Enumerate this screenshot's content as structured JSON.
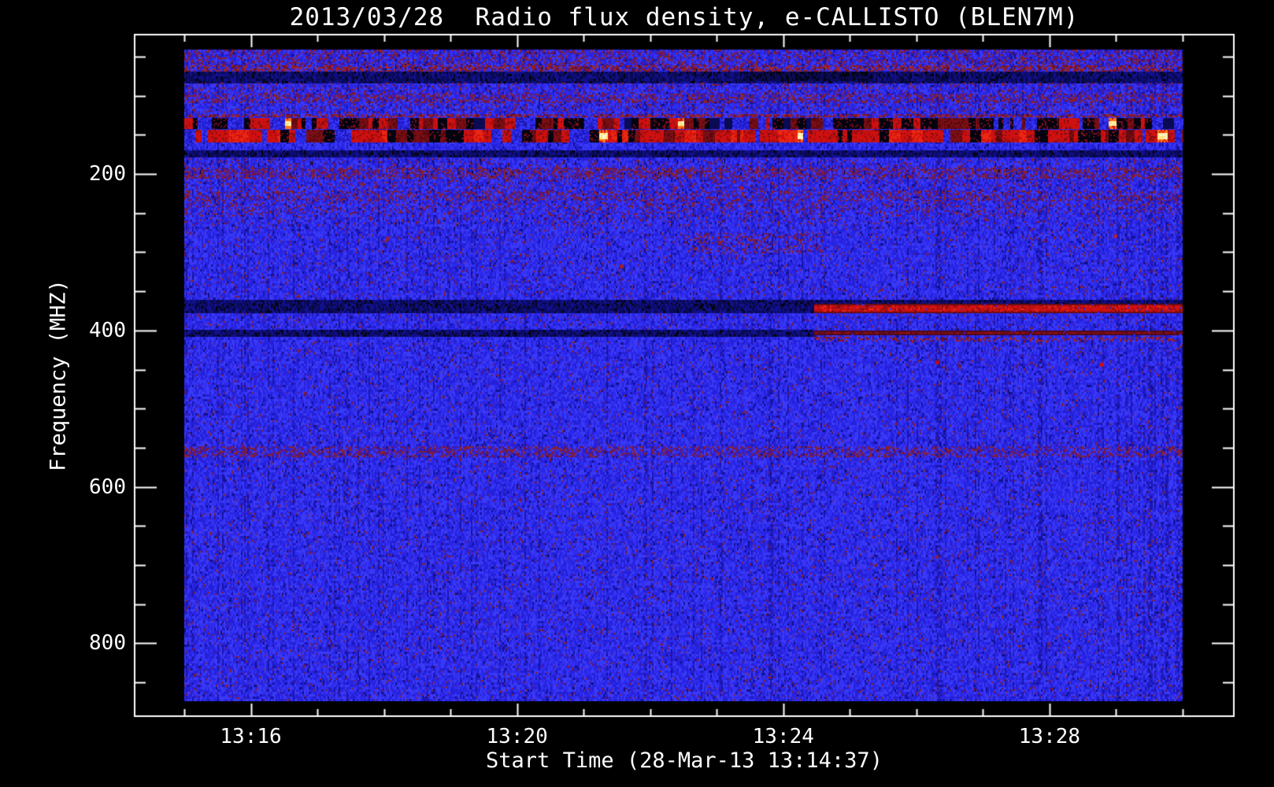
{
  "figure": {
    "background": "#000000",
    "foreground": "#ffffff"
  },
  "chart_data": {
    "type": "heatmap",
    "subtype": "radio-spectrogram",
    "title": "2013/03/28  Radio flux density, e-CALLISTO (BLEN7M)",
    "xlabel": "Start Time (28-Mar-13 13:14:37)",
    "ylabel": "Frequency (MHZ)",
    "y_axis_inverted": true,
    "ylim_mhz": [
      41,
      873
    ],
    "x_span_minutes": 15,
    "x_major_ticks": [
      {
        "label": "13:16",
        "t_min": 1
      },
      {
        "label": "13:20",
        "t_min": 5
      },
      {
        "label": "13:24",
        "t_min": 9
      },
      {
        "label": "13:28",
        "t_min": 13
      }
    ],
    "x_minor_t_min": [
      0,
      2,
      3,
      4,
      6,
      7,
      8,
      10,
      11,
      12,
      14,
      15
    ],
    "y_major_ticks": [
      {
        "label": "200",
        "f": 200
      },
      {
        "label": "400",
        "f": 400
      },
      {
        "label": "600",
        "f": 600
      },
      {
        "label": "800",
        "f": 800
      }
    ],
    "y_minor_f": [
      50,
      100,
      150,
      250,
      300,
      350,
      450,
      500,
      550,
      650,
      700,
      750,
      850
    ],
    "colormap": {
      "base_blue": [
        "#1b16ae",
        "#2420d8",
        "#2e2bee",
        "#3a3af6"
      ],
      "navy": "#11108c",
      "deep_navy": "#0a0a55",
      "black": "#030310",
      "speckle_purple": [
        "#6e1650",
        "#84203a",
        "#5a1478",
        "#8a2424"
      ],
      "speckle_red": [
        "#8a1a20",
        "#a02828",
        "#6a1020",
        "#96203a"
      ],
      "red": "#cf1010",
      "dark_red": "#7a0e14",
      "orange": "#ff7714",
      "yellow": "#ffe27a",
      "hot_white": "#fff6c8"
    },
    "bands": [
      {
        "kind": "speckle",
        "f0": 41,
        "f1": 60,
        "p": 0.3
      },
      {
        "kind": "speckle",
        "f0": 61,
        "f1": 68,
        "p": 0.52,
        "red": true,
        "dash": 0.06
      },
      {
        "kind": "dark",
        "f0": 69,
        "f1": 82,
        "dash": 0.1
      },
      {
        "kind": "dark",
        "f0": 69,
        "f1": 80,
        "x0": 0.56,
        "x1": 0.69,
        "dash": 0.22,
        "deep": true
      },
      {
        "kind": "speckle",
        "f0": 83,
        "f1": 96,
        "p": 0.15
      },
      {
        "kind": "speckle",
        "f0": 97,
        "f1": 109,
        "p": 0.42
      },
      {
        "kind": "speckle",
        "f0": 110,
        "f1": 122,
        "p": 0.15
      },
      {
        "kind": "speckle",
        "f0": 123,
        "f1": 128,
        "p": 0.55,
        "red": true
      },
      {
        "kind": "rfi_mixed",
        "f0": 129,
        "f1": 143
      },
      {
        "kind": "rfi_strong",
        "f0": 144,
        "f1": 160
      },
      {
        "kind": "dark",
        "f0": 170,
        "f1": 179,
        "dash": 0.12
      },
      {
        "kind": "speckle",
        "f0": 180,
        "f1": 191,
        "p": 0.12,
        "dash": 0.1
      },
      {
        "kind": "speckle",
        "f0": 192,
        "f1": 205,
        "p": 0.45,
        "dash": 0.08
      },
      {
        "kind": "speckle",
        "f0": 206,
        "f1": 220,
        "p": 0.15
      },
      {
        "kind": "speckle",
        "f0": 221,
        "f1": 235,
        "p": 0.35
      },
      {
        "kind": "speckle",
        "f0": 236,
        "f1": 251,
        "p": 0.2
      },
      {
        "kind": "speckle",
        "f0": 252,
        "f1": 266,
        "p": 0.1
      },
      {
        "kind": "speckle",
        "f0": 267,
        "f1": 360,
        "p": 0.05
      },
      {
        "kind": "speckle",
        "f0": 275,
        "f1": 302,
        "p": 0.22,
        "x0": 0.5,
        "x1": 0.64
      },
      {
        "kind": "dark",
        "f0": 361,
        "f1": 365,
        "dash": 0.05
      },
      {
        "kind": "dark",
        "f0": 366,
        "f1": 377,
        "x1": 0.631,
        "dash": 0.15
      },
      {
        "kind": "dark",
        "f0": 399,
        "f1": 406,
        "x1": 0.631,
        "dash": 0.12
      },
      {
        "kind": "speckle",
        "f0": 378,
        "f1": 398,
        "p": 0.05
      },
      {
        "kind": "speckle",
        "f0": 408,
        "f1": 413,
        "p": 0.35,
        "red": true,
        "x0": 0.631
      },
      {
        "kind": "speckle",
        "f0": 414,
        "f1": 547,
        "p": 0.04
      },
      {
        "kind": "speckle",
        "f0": 548,
        "f1": 562,
        "p": 0.38
      },
      {
        "kind": "speckle",
        "f0": 563,
        "f1": 873,
        "p": 0.045
      }
    ],
    "rfi_lines": [
      {
        "f0": 366,
        "f1": 377,
        "start_frac": 0.631,
        "level": "bright"
      },
      {
        "f0": 400,
        "f1": 406,
        "start_frac": 0.631,
        "level": "dark"
      }
    ],
    "dots": [
      {
        "t": 0.557,
        "f": 216,
        "c": "#c01616",
        "s": 4
      },
      {
        "t": 0.202,
        "f": 280,
        "c": "#8a2050",
        "s": 5
      },
      {
        "t": 0.233,
        "f": 279,
        "c": "#7a1a44",
        "s": 4
      },
      {
        "t": 0.436,
        "f": 316,
        "c": "#9c2030",
        "s": 5
      },
      {
        "t": 0.752,
        "f": 438,
        "c": "#b01212",
        "s": 5
      },
      {
        "t": 0.775,
        "f": 443,
        "c": "#6e1640",
        "s": 4
      },
      {
        "t": 0.917,
        "f": 441,
        "c": "#cc1010",
        "s": 5
      },
      {
        "t": 0.931,
        "f": 277,
        "c": "#c22222",
        "s": 4
      }
    ]
  }
}
